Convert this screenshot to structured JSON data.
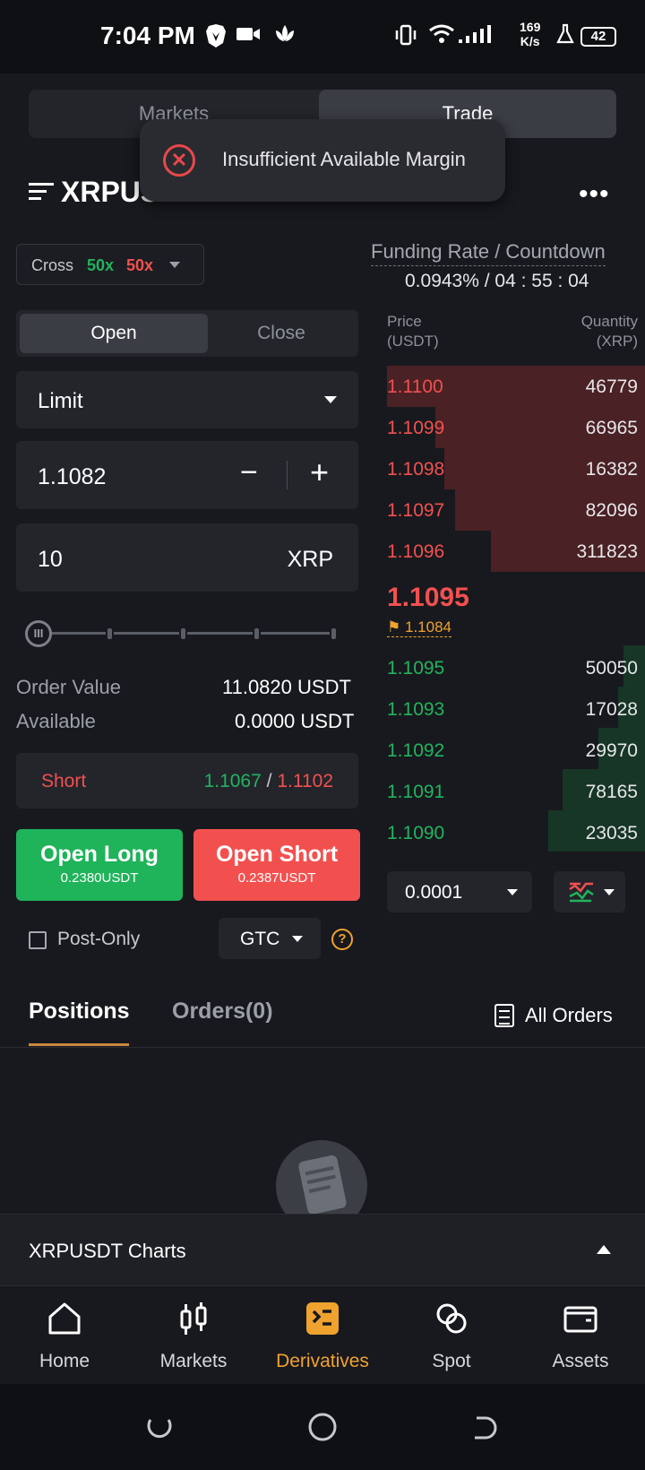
{
  "status_bar": {
    "time": "7:04 PM",
    "net_speed": "169",
    "net_unit": "K/s",
    "battery": "42"
  },
  "top_tabs": {
    "markets": "Markets",
    "trade": "Trade"
  },
  "toast": {
    "message": "Insufficient Available Margin"
  },
  "header": {
    "symbol": "XRPUSDT",
    "more": "•••"
  },
  "margin": {
    "mode": "Cross",
    "long_leverage": "50x",
    "short_leverage": "50x"
  },
  "funding": {
    "label": "Funding Rate / Countdown",
    "value": "0.0943% / 04 : 55 : 04"
  },
  "order_form": {
    "open": "Open",
    "close": "Close",
    "order_type": "Limit",
    "price": "1.1082",
    "minus": "−",
    "plus": "+",
    "quantity": "10",
    "quantity_unit": "XRP",
    "order_value_label": "Order Value",
    "order_value": "11.0820 USDT",
    "available_label": "Available",
    "available": "0.0000 USDT",
    "position_side": "Short",
    "bid_price": "1.1067",
    "slash": "/",
    "ask_price": "1.1102",
    "open_long": "Open Long",
    "open_long_cost": "0.2380USDT",
    "open_short": "Open Short",
    "open_short_cost": "0.2387USDT",
    "post_only": "Post-Only",
    "tif": "GTC",
    "help": "?"
  },
  "orderbook": {
    "price_header_1": "Price",
    "price_header_2": "(USDT)",
    "qty_header_1": "Quantity",
    "qty_header_2": "(XRP)",
    "asks": [
      {
        "price": "1.1100",
        "qty": "46779"
      },
      {
        "price": "1.1099",
        "qty": "66965"
      },
      {
        "price": "1.1098",
        "qty": "16382"
      },
      {
        "price": "1.1097",
        "qty": "82096"
      },
      {
        "price": "1.1096",
        "qty": "311823"
      }
    ],
    "last_price": "1.1095",
    "mark_price": "1.1084",
    "bids": [
      {
        "price": "1.1095",
        "qty": "50050"
      },
      {
        "price": "1.1093",
        "qty": "17028"
      },
      {
        "price": "1.1092",
        "qty": "29970"
      },
      {
        "price": "1.1091",
        "qty": "78165"
      },
      {
        "price": "1.1090",
        "qty": "23035"
      }
    ],
    "tick_size": "0.0001"
  },
  "positions_tabs": {
    "positions": "Positions",
    "orders": "Orders(0)",
    "all_orders": "All Orders"
  },
  "charts_bar": {
    "label": "XRPUSDT Charts"
  },
  "bottom_nav": [
    {
      "label": "Home",
      "icon": "home-icon"
    },
    {
      "label": "Markets",
      "icon": "candlestick-icon"
    },
    {
      "label": "Derivatives",
      "icon": "derivatives-icon"
    },
    {
      "label": "Spot",
      "icon": "spot-icon"
    },
    {
      "label": "Assets",
      "icon": "wallet-icon"
    }
  ],
  "colors": {
    "buy": "#22b35e",
    "sell": "#f2504f",
    "accent": "#f0a22e",
    "bg": "#18191e"
  }
}
